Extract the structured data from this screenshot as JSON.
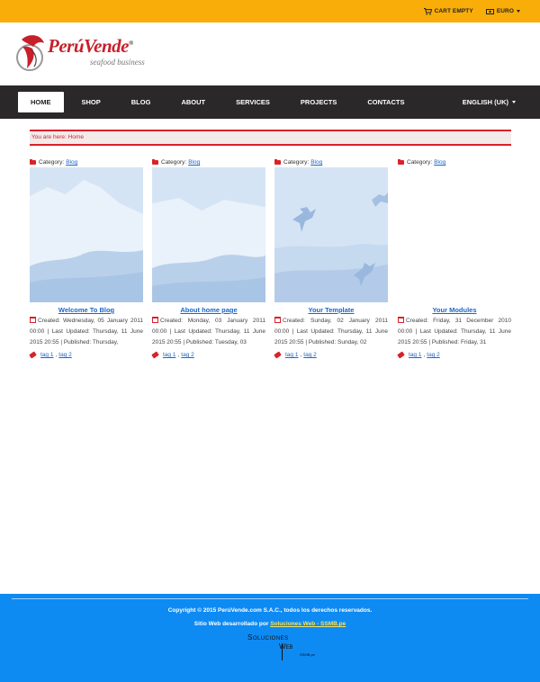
{
  "topbar": {
    "cart_label": "CART EMPTY",
    "currency_label": "EURO"
  },
  "logo": {
    "brand": "PerúVende",
    "registered": "®",
    "tagline": "seafood business"
  },
  "nav": {
    "items": [
      {
        "label": "HOME",
        "active": true
      },
      {
        "label": "SHOP"
      },
      {
        "label": "BLOG"
      },
      {
        "label": "ABOUT"
      },
      {
        "label": "SERVICES"
      },
      {
        "label": "PROJECTS"
      },
      {
        "label": "CONTACTS"
      }
    ],
    "language": "ENGLISH (UK)"
  },
  "breadcrumb": {
    "prefix": "You are here:",
    "current": "Home"
  },
  "posts": [
    {
      "category_prefix": "Category:",
      "category": "Blog",
      "title": "Welcome To Blog",
      "meta": "Created: Wednesday, 05 January 2011 00:00 | Last Updated: Thursday, 11 June 2015 20:55 | Published: Thursday,",
      "tag1": "tag 1",
      "tag2": "tag 2"
    },
    {
      "category_prefix": "Category:",
      "category": "Blog",
      "title": "About home page",
      "meta": "Created: Monday, 03 January 2011 00:00 | Last Updated: Thursday, 11 June 2015 20:55 | Published: Tuesday, 03",
      "tag1": "tag 1",
      "tag2": "tag 2"
    },
    {
      "category_prefix": "Category:",
      "category": "Blog",
      "title": "Your Template",
      "meta": "Created: Sunday, 02 January 2011 00:00 | Last Updated: Thursday, 11 June 2015 20:55 | Published: Sunday, 02",
      "tag1": "tag 1",
      "tag2": "tag 2"
    },
    {
      "category_prefix": "Category:",
      "category": "Blog",
      "title": "Your Modules",
      "meta": "Created: Friday, 31 December 2010 00:00 | Last Updated: Thursday, 11 June 2015 20:55 | Published: Friday, 31",
      "tag1": "tag 1",
      "tag2": "tag 2"
    }
  ],
  "footer": {
    "copyright": "Copyright © 2015 PerúVende.com S.A.C., todos los derechos reservados.",
    "dev_prefix": "Sitio Web desarrollado por",
    "dev_link": "Soluciones Web - SSMB.pe",
    "logo_line1": "Soluciones",
    "logo_line2": "Web",
    "logo_line3": "SSMB.pe"
  },
  "colors": {
    "topbar": "#f8ad08",
    "nav": "#2a2828",
    "accent_red": "#d9222a",
    "link_blue": "#1a66c9",
    "footer": "#0e8af3"
  }
}
